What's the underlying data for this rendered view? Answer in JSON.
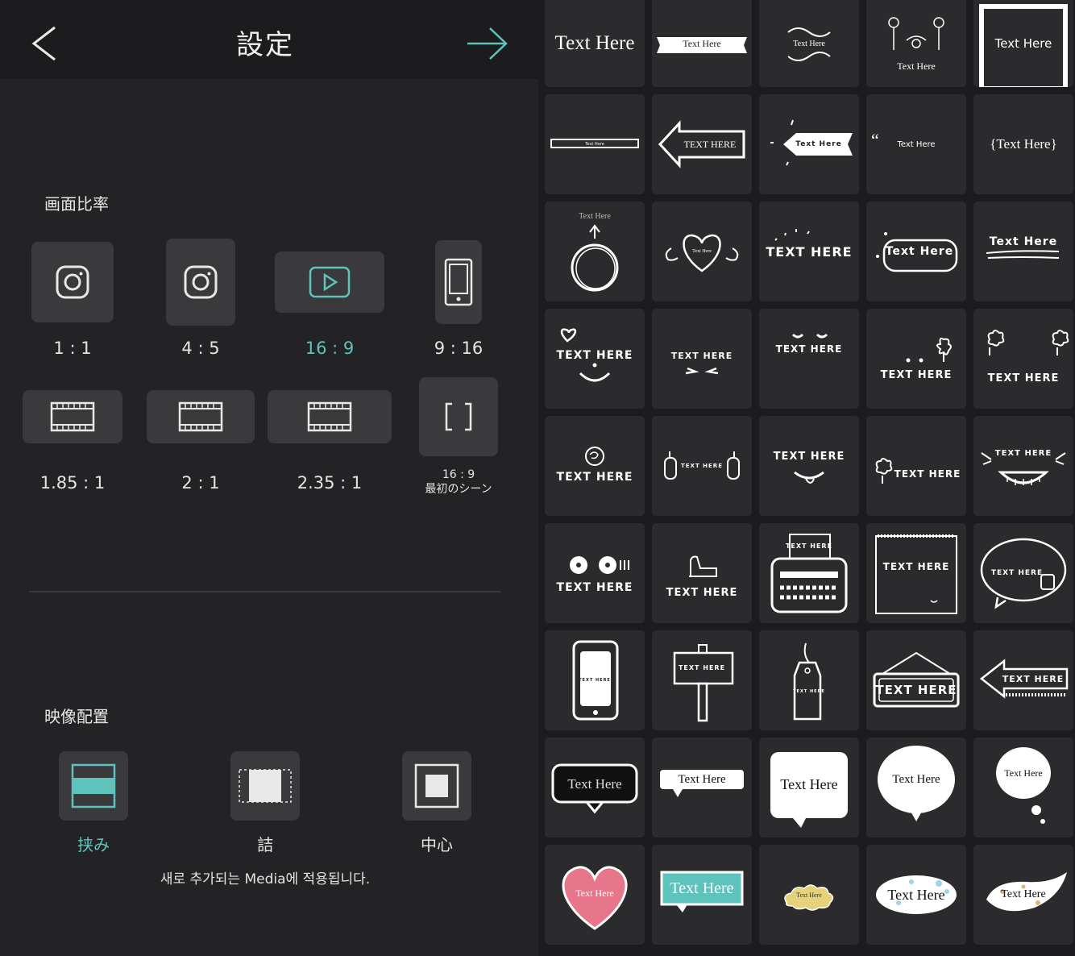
{
  "header": {
    "title": "設定"
  },
  "aspect": {
    "section_title": "画面比率",
    "items": [
      {
        "label": "1:1",
        "icon": "instagram-icon"
      },
      {
        "label": "4:5",
        "icon": "instagram-icon"
      },
      {
        "label": "16:9",
        "icon": "youtube-play-icon",
        "selected": true
      },
      {
        "label": "9:16",
        "icon": "phone-icon"
      },
      {
        "label": "1.85:1",
        "icon": "filmstrip-icon"
      },
      {
        "label": "2:1",
        "icon": "filmstrip-icon"
      },
      {
        "label": "2.35:1",
        "icon": "filmstrip-icon"
      },
      {
        "label": "16:9",
        "sublabel": "最初のシーン",
        "icon": "brackets-icon"
      }
    ]
  },
  "placement": {
    "section_title": "映像配置",
    "items": [
      {
        "label": "挟み",
        "icon": "letterbox-icon",
        "selected": true
      },
      {
        "label": "詰",
        "icon": "fill-icon"
      },
      {
        "label": "中心",
        "icon": "center-icon"
      }
    ],
    "note": "새로 추가되는 Media에 적용됩니다."
  },
  "colors": {
    "accent": "#5ec3bd",
    "background": "#232325",
    "tile": "#2b2b2d",
    "button": "#3a3a3c"
  },
  "templates": [
    {
      "text": "Text Here",
      "style": "plain-serif"
    },
    {
      "text": "Text Here",
      "style": "ribbon-banner"
    },
    {
      "text": "Text Here",
      "style": "swirl-ornament"
    },
    {
      "text": "Text Here",
      "style": "floral-birds"
    },
    {
      "text": "Text Here",
      "style": "white-frame"
    },
    {
      "text": "Text Here",
      "style": "thin-bar"
    },
    {
      "text": "TEXT HERE",
      "style": "arrow-left-sign"
    },
    {
      "text": "Text Here",
      "style": "sparkle-tag"
    },
    {
      "text": "Text Here",
      "style": "quote-mark"
    },
    {
      "text": "{Text Here}",
      "style": "curly-braces"
    },
    {
      "text": "Text Here",
      "style": "scribble-circle"
    },
    {
      "text": "Text Here",
      "style": "winged-heart"
    },
    {
      "text": "TEXT HERE",
      "style": "doodle-dots"
    },
    {
      "text": "Text Here",
      "style": "rounded-pill"
    },
    {
      "text": "Text Here",
      "style": "underline-scribble"
    },
    {
      "text": "TEXT HERE",
      "style": "heart-smile"
    },
    {
      "text": "TEXT HERE",
      "style": "squint-face"
    },
    {
      "text": "TEXT HERE",
      "style": "closed-eyes"
    },
    {
      "text": "TEXT HERE",
      "style": "flower-dots"
    },
    {
      "text": "TEXT HERE",
      "style": "twin-flowers"
    },
    {
      "text": "TEXT HERE",
      "style": "rose"
    },
    {
      "text": "TEXT HERE",
      "style": "thumbs-sides"
    },
    {
      "text": "TEXT HERE",
      "style": "tongue-face"
    },
    {
      "text": "TEXT HERE",
      "style": "flower-side"
    },
    {
      "text": "TEXT HERE",
      "style": "big-grin"
    },
    {
      "text": "TEXT HERE",
      "style": "eyes-dots"
    },
    {
      "text": "TEXT HERE",
      "style": "thumbs-up"
    },
    {
      "text": "TEXT HERE",
      "style": "typewriter"
    },
    {
      "text": "TEXT HERE",
      "style": "notepad"
    },
    {
      "text": "TEXT HERE",
      "style": "speech-cup"
    },
    {
      "text": "TEXT HERE",
      "style": "smartphone"
    },
    {
      "text": "TEXT HERE",
      "style": "signpost"
    },
    {
      "text": "TEXT HERE",
      "style": "hanging-tag"
    },
    {
      "text": "TEXT HERE",
      "style": "hanging-board"
    },
    {
      "text": "TEXT HERE",
      "style": "arrow-board"
    },
    {
      "text": "Text Here",
      "style": "pixel-bubble-dark"
    },
    {
      "text": "Text Here",
      "style": "pixel-bubble-wide"
    },
    {
      "text": "Text Here",
      "style": "pixel-bubble-square"
    },
    {
      "text": "Text Here",
      "style": "pixel-bubble-round"
    },
    {
      "text": "Text Here",
      "style": "pixel-thought"
    },
    {
      "text": "Text Here",
      "style": "pixel-heart-pink"
    },
    {
      "text": "Text Here",
      "style": "pixel-teal-box"
    },
    {
      "text": "Text Here",
      "style": "yellow-cloud"
    },
    {
      "text": "Text Here",
      "style": "dotted-bubble"
    },
    {
      "text": "Text Here",
      "style": "dotted-swoosh"
    }
  ]
}
